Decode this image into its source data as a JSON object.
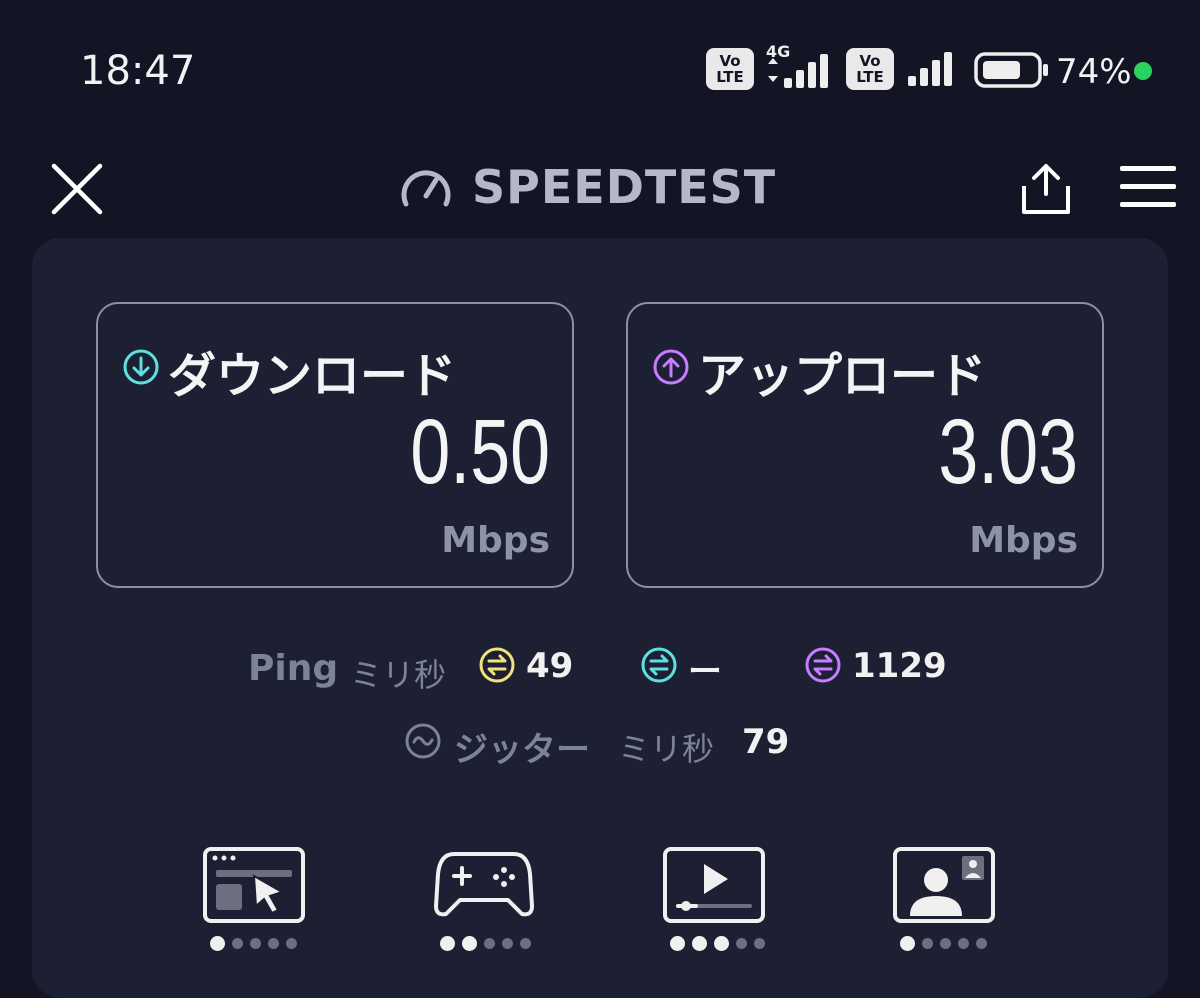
{
  "status_bar": {
    "time": "18:47",
    "volte_label": "Vo\nLTE",
    "network_type": "4G",
    "battery_percent": "74%",
    "battery_level": 0.74,
    "colors": {
      "dot": "#2bd161"
    }
  },
  "header": {
    "title": "SPEEDTEST",
    "close_icon": "close-icon",
    "share_icon": "share-icon",
    "menu_icon": "menu-icon"
  },
  "download": {
    "label": "ダウンロード",
    "value": "0.50",
    "unit": "Mbps",
    "color": "#5fe0e0"
  },
  "upload": {
    "label": "アップロード",
    "value": "3.03",
    "unit": "Mbps",
    "color": "#c77dff"
  },
  "ping": {
    "label": "Ping",
    "unit": "ミリ秒",
    "idle": "49",
    "download": "ー",
    "upload": "1129",
    "colors": {
      "idle": "#f2e27a",
      "download": "#5fe0e0",
      "upload": "#c77dff"
    }
  },
  "jitter": {
    "label": "ジッター",
    "unit": "ミリ秒",
    "value": "79"
  },
  "activities": [
    {
      "icon": "web-browsing-icon",
      "rating": 1,
      "max": 5
    },
    {
      "icon": "gaming-icon",
      "rating": 2,
      "max": 5
    },
    {
      "icon": "video-streaming-icon",
      "rating": 3,
      "max": 5
    },
    {
      "icon": "video-call-icon",
      "rating": 1,
      "max": 5
    }
  ]
}
